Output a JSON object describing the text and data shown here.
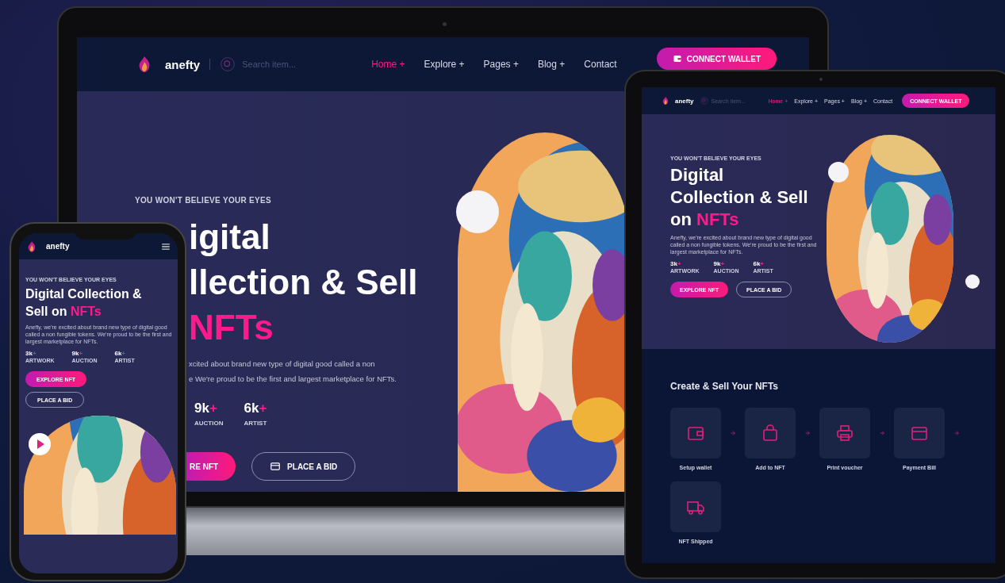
{
  "laptop": {
    "nav": {
      "brand": "anefty",
      "search": {
        "placeholder": "Search item..."
      },
      "menu": [
        {
          "label": "Home +",
          "selected": true
        },
        {
          "label": "Explore +",
          "selected": false
        },
        {
          "label": "Pages +",
          "selected": false
        },
        {
          "label": "Blog +",
          "selected": false
        },
        {
          "label": "Contact",
          "selected": false
        }
      ],
      "action": "CONNECT WALLET"
    },
    "hero": {
      "eyebrow": "YOU WON'T BELIEVE YOUR EYES",
      "heading": {
        "lines": [
          "igital",
          "llection & Sell"
        ],
        "highlight": "NFTs"
      },
      "text_lines": [
        "xcited about brand new type of digital good called a non",
        "e We're proud to be the first and largest marketplace for NFTs."
      ],
      "stats": [
        {
          "value": "9k",
          "plus": "+",
          "label": "AUCTION"
        },
        {
          "value": "6k",
          "plus": "+",
          "label": "ARTIST"
        }
      ],
      "buttons": [
        {
          "kind": "primary",
          "label": "RE NFT"
        },
        {
          "kind": "outline",
          "label": "PLACE A BID"
        }
      ]
    }
  },
  "tablet": {
    "nav": {
      "brand": "anefty",
      "search": {
        "placeholder": "Search item..."
      },
      "menu": [
        {
          "label": "Home +",
          "selected": true
        },
        {
          "label": "Explore +",
          "selected": false
        },
        {
          "label": "Pages +",
          "selected": false
        },
        {
          "label": "Blog +",
          "selected": false
        },
        {
          "label": "Contact",
          "selected": false
        }
      ],
      "action": "CONNECT WALLET"
    },
    "hero": {
      "eyebrow": "YOU WON'T BELIEVE YOUR EYES",
      "heading": {
        "lines": [
          "Digital",
          "Collection & Sell"
        ],
        "last": "on ",
        "highlight": "NFTs"
      },
      "text": "Anefty, we're excited about brand new type of digital good called a non fungible tokens. We're proud to be the first and largest marketplace for NFTs.",
      "stats": [
        {
          "value": "3k",
          "plus": "+",
          "label": "ARTWORK"
        },
        {
          "value": "9k",
          "plus": "+",
          "label": "AUCTION"
        },
        {
          "value": "6k",
          "plus": "+",
          "label": "ARTIST"
        }
      ],
      "buttons": [
        {
          "kind": "primary",
          "label": "EXPLORE NFT"
        },
        {
          "kind": "outline",
          "label": "PLACE A BID"
        }
      ]
    },
    "steps_title": "Create & Sell Your NFTs",
    "steps": [
      "Setup wallet",
      "Add to NFT",
      "Print voucher",
      "Payment Bill",
      "NFT Shipped"
    ]
  },
  "phone": {
    "nav": {
      "brand": "anefty"
    },
    "hero": {
      "eyebrow": "YOU WON'T BELIEVE YOUR EYES",
      "heading": {
        "lines": [
          "Digital Collection &"
        ],
        "last": "Sell on ",
        "highlight": "NFTs"
      },
      "text": "Anefty, we're excited about brand new type of digital good called a non fungible tokens. We're proud to be the first and largest marketplace for NFTs.",
      "stats": [
        {
          "value": "3k",
          "plus": "+",
          "label": "ARTWORK"
        },
        {
          "value": "9k",
          "plus": "+",
          "label": "AUCTION"
        },
        {
          "value": "6k",
          "plus": "+",
          "label": "ARTIST"
        }
      ],
      "buttons": [
        {
          "kind": "primary",
          "label": "EXPLORE NFT"
        },
        {
          "kind": "outline",
          "label": "PLACE A BID"
        }
      ]
    }
  }
}
